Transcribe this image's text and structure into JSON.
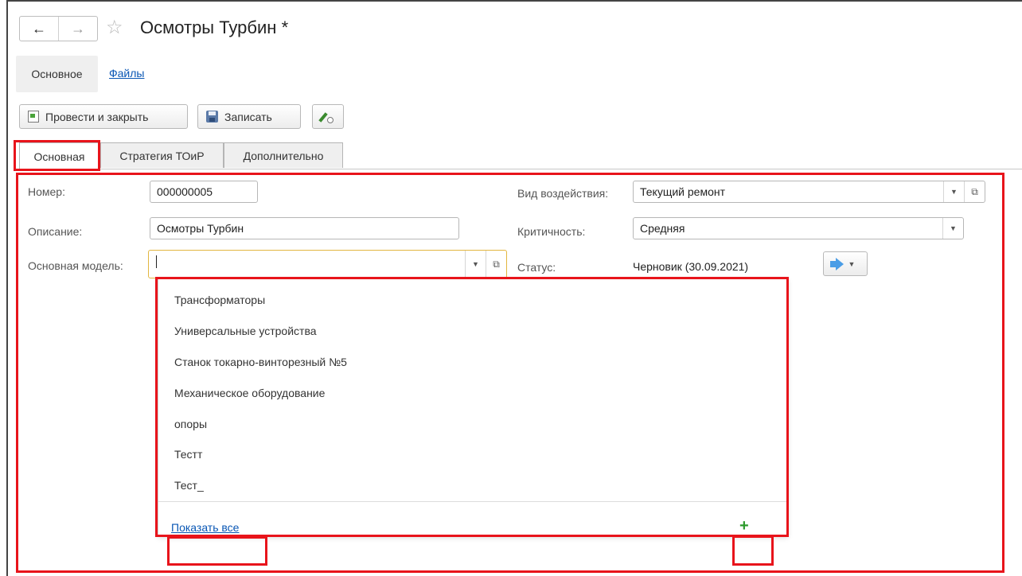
{
  "window": {
    "title": "Осмотры Турбин *",
    "back_glyph": "←",
    "forward_glyph": "→",
    "star_glyph": "☆"
  },
  "panel": {
    "active": "Основное",
    "link": "Файлы"
  },
  "toolbar": {
    "post_close_label": "Провести и закрыть",
    "save_label": "Записать",
    "edit_icon": "pen-clock-icon"
  },
  "tabs": [
    {
      "label": "Основная",
      "active": true
    },
    {
      "label": "Стратегия ТОиР",
      "active": false
    },
    {
      "label": "Дополнительно",
      "active": false
    }
  ],
  "form": {
    "number_label": "Номер:",
    "number_value": "000000005",
    "description_label": "Описание:",
    "description_value": "Осмотры Турбин",
    "model_label": "Основная модель:",
    "model_value": "",
    "impact_label": "Вид воздействия:",
    "impact_value": "Текущий ремонт",
    "criticality_label": "Критичность:",
    "criticality_value": "Средняя",
    "status_label": "Статус:",
    "status_value": "Черновик (30.09.2021)"
  },
  "dropdown": {
    "items": [
      "Трансформаторы",
      "Универсальные устройства",
      "Станок токарно-винторезный №5",
      "Механическое оборудование",
      "опоры",
      "Тестт",
      "Тест_"
    ],
    "show_all": "Показать все",
    "add_glyph": "+"
  },
  "colors": {
    "highlight": "#e8141b",
    "link": "#0a57b5",
    "focus_border": "#e2b640",
    "add_green": "#2c9a2c",
    "status_arrow": "#4a9de6"
  }
}
